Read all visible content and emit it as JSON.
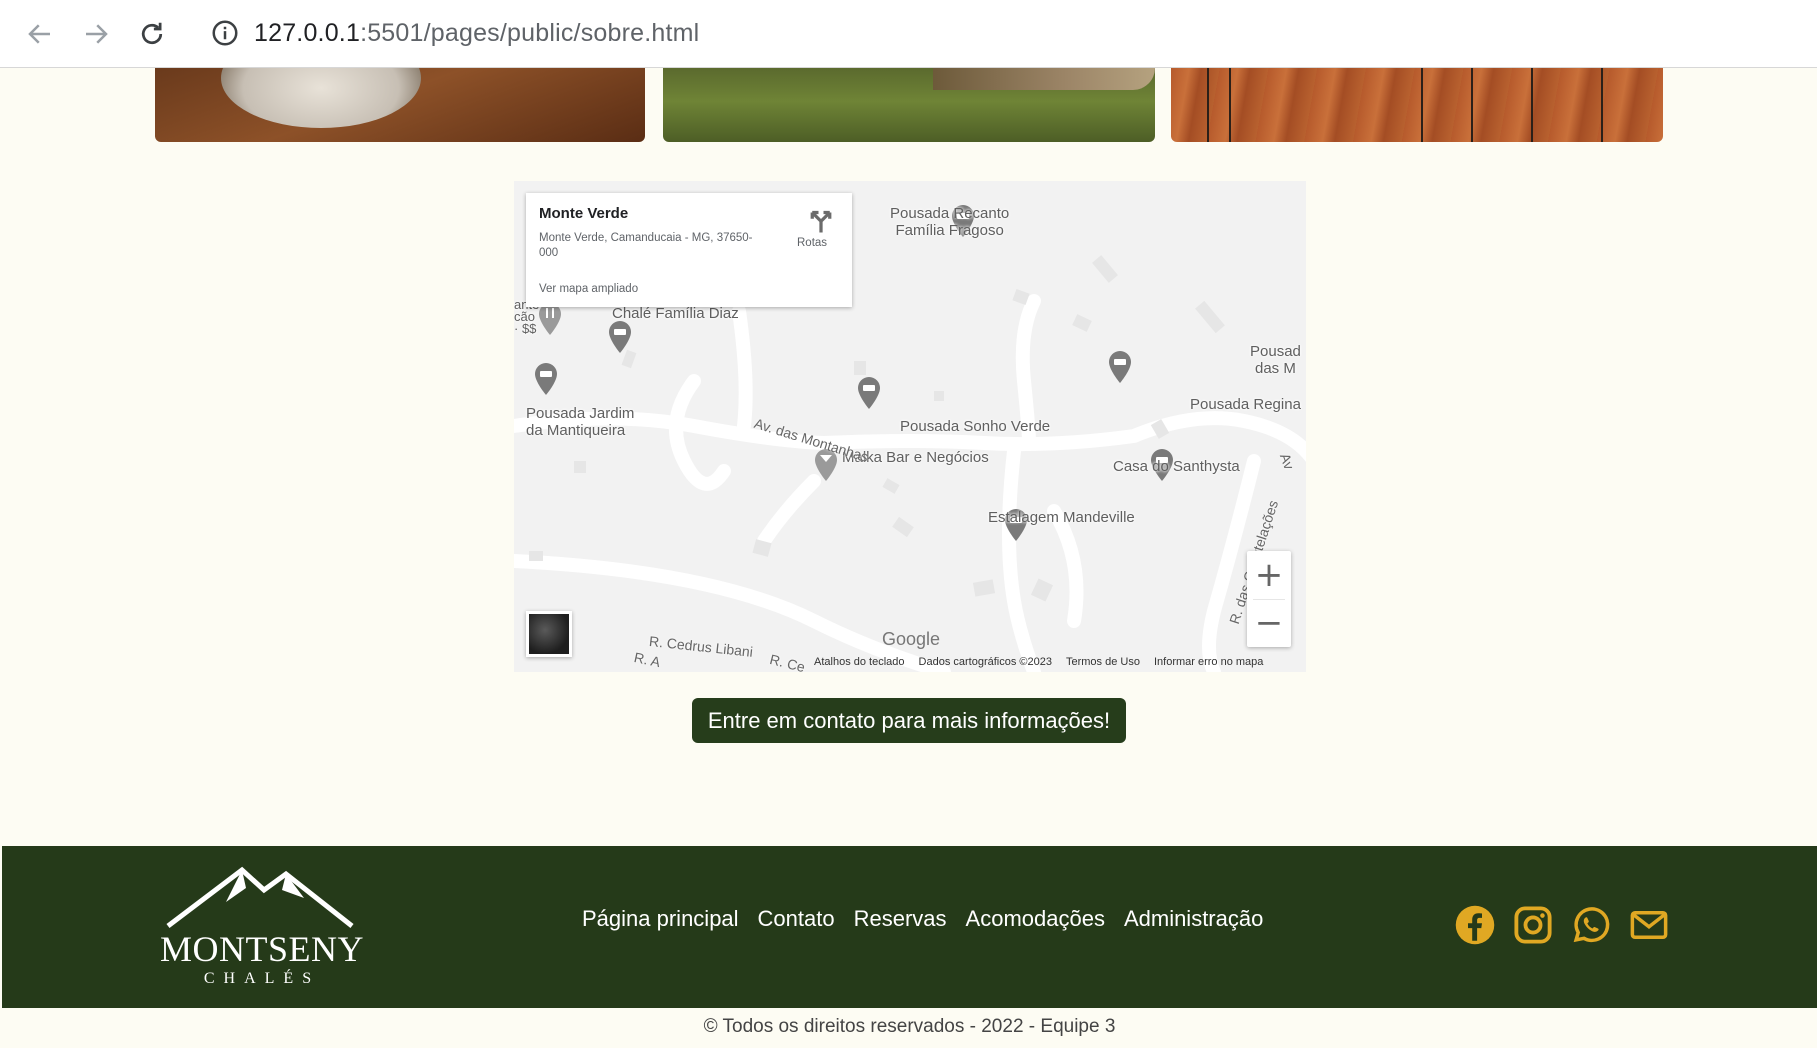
{
  "browser": {
    "url_host": "127.0.0.1",
    "url_path": ":5501/pages/public/sobre.html"
  },
  "map": {
    "card": {
      "title": "Monte Verde",
      "address": "Monte Verde, Camanducaia - MG, 37650-000",
      "link": "Ver mapa ampliado",
      "directions": "Rotas"
    },
    "places": {
      "recanto": "Pousada Recanto\nFamília Fragoso",
      "chale_diaz": "Chalé Família Diaz",
      "jardim": "Pousada Jardim\nda Mantiqueira",
      "sonho_verde": "Pousada Sonho Verde",
      "malka": "Malka Bar e Negócios",
      "santhysta": "Casa do Santhysta",
      "mandeville": "Estalagem Mandeville",
      "regina": "Pousada Regina",
      "pousad_cut": "Pousad\ndas M",
      "left_cut": "ante\ncão\n· $$"
    },
    "streets": {
      "montanhas": "Av. das Montanhas",
      "cedrus": "R. Cedrus Libani",
      "constelacoes": "R. das Constelações",
      "r_a": "R. A",
      "r_ce": "R. Ce",
      "av": "Av"
    },
    "google": "Google",
    "footer": [
      "Atalhos do teclado",
      "Dados cartográficos ©2023",
      "Termos de Uso",
      "Informar erro no mapa"
    ]
  },
  "cta": {
    "label": "Entre em contato para mais informações!"
  },
  "footer": {
    "logo_word": "MONTSENY",
    "logo_sub": "CHALÉS",
    "nav": [
      "Página principal",
      "Contato",
      "Reservas",
      "Acomodações",
      "Administração"
    ],
    "copyright": "© Todos os direitos reservados - 2022 - Equipe 3"
  },
  "colors": {
    "footer_bg": "#253a19",
    "icon_gold": "#e0a823",
    "page_bg": "#fdfcf3"
  },
  "icons": [
    "back-arrow-icon",
    "forward-arrow-icon",
    "reload-icon",
    "info-icon",
    "facebook-icon",
    "instagram-icon",
    "whatsapp-icon",
    "mail-icon"
  ]
}
